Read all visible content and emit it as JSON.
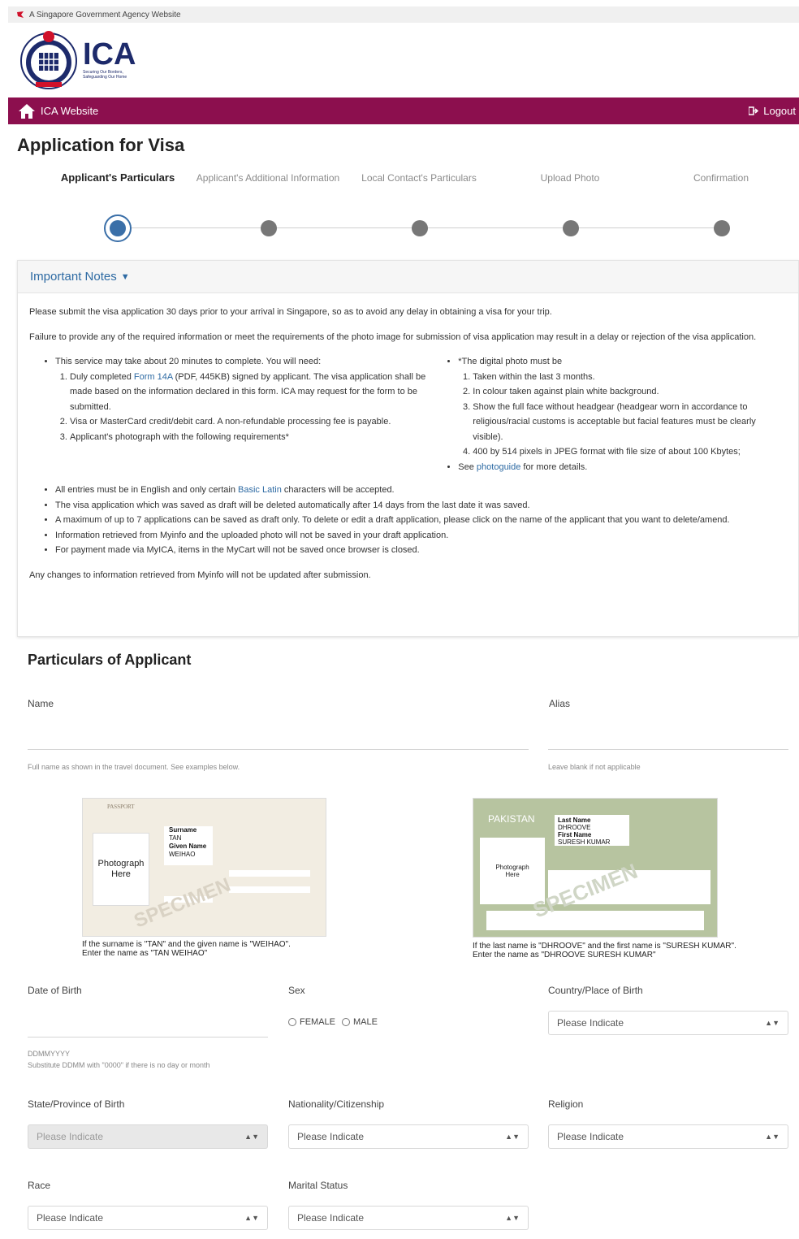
{
  "gov_banner": {
    "text": "A Singapore Government Agency Website"
  },
  "logo": {
    "acronym": "ICA",
    "tagline_1": "Securing Our Borders,",
    "tagline_2": "Safeguarding Our Home"
  },
  "nav": {
    "home_label": "ICA Website",
    "logout_label": "Logout"
  },
  "page_title": "Application for Visa",
  "steps": [
    {
      "label": "Applicant's Particulars",
      "active": true
    },
    {
      "label": "Applicant's Additional Information",
      "active": false
    },
    {
      "label": "Local Contact's Particulars",
      "active": false
    },
    {
      "label": "Upload Photo",
      "active": false
    },
    {
      "label": "Confirmation",
      "active": false
    }
  ],
  "notes": {
    "title": "Important Notes",
    "p1": "Please submit the visa application 30 days prior to your arrival in Singapore, so as to avoid any delay in obtaining a visa for your trip.",
    "p2": "Failure to provide any of the required information or meet the requirements of the photo image for submission of visa application may result in a delay or rejection of the visa application.",
    "left_intro": "This service may take about 20 minutes to complete. You will need:",
    "left_items": {
      "i1_pre": "Duly completed ",
      "i1_link": "Form 14A",
      "i1_post": " (PDF, 445KB) signed by applicant. The visa application shall be made based on the information declared in this form. ICA may request for the form to be submitted.",
      "i2": "Visa or MasterCard credit/debit card. A non-refundable processing fee is payable.",
      "i3": "Applicant's photograph with the following requirements*"
    },
    "right_intro": "*The digital photo must be",
    "right_items": {
      "r1": "Taken within the last 3 months.",
      "r2": "In colour taken against plain white background.",
      "r3": "Show the full face without headgear (headgear worn in accordance to religious/racial customs is acceptable but facial features must be clearly visible).",
      "r4": "400 by 514 pixels in JPEG format with file size of about 100 Kbytes;"
    },
    "see_pre": "See ",
    "see_link": "photoguide",
    "see_post": " for more details.",
    "b1_pre": "All entries must be in English and only certain ",
    "b1_link": "Basic Latin",
    "b1_post": " characters will be accepted.",
    "b2": "The visa application which was saved as draft will be deleted automatically after 14 days from the last date it was saved.",
    "b3": "A maximum of up to 7 applications can be saved as draft only. To delete or edit a draft application, please click on the name of the applicant that you want to delete/amend.",
    "b4": "Information retrieved from Myinfo and the uploaded photo will not be saved in your draft application.",
    "b5": "For payment made via MyICA, items in the MyCart will not be saved once browser is closed.",
    "footer": "Any changes to information retrieved from Myinfo will not be updated after submission."
  },
  "section_title": "Particulars of Applicant",
  "form": {
    "name_label": "Name",
    "name_hint": "Full name as shown in the travel document. See examples below.",
    "alias_label": "Alias",
    "alias_hint": "Leave blank if not applicable",
    "example1": {
      "doc_title": "PASSPORT",
      "surname_label": "Surname",
      "surname_value": "TAN",
      "given_label": "Given Name",
      "given_value": "WEIHAO",
      "photo_text_1": "Photograph",
      "photo_text_2": "Here",
      "specimen": "SPECIMEN",
      "caption_1": "If the surname is \"TAN\" and the given name is \"WEIHAO\".",
      "caption_2": "Enter the name as \"TAN WEIHAO\""
    },
    "example2": {
      "country": "PAKISTAN",
      "last_label": "Last Name",
      "last_value": "DHROOVE",
      "first_label": "First Name",
      "first_value": "SURESH KUMAR",
      "photo_text_1": "Photograph",
      "photo_text_2": "Here",
      "specimen": "SPECIMEN",
      "caption_1": "If the last name is \"DHROOVE\" and the first name is \"SURESH KUMAR\".",
      "caption_2": "Enter the name as \"DHROOVE SURESH KUMAR\""
    },
    "dob_label": "Date of Birth",
    "dob_hint_1": "DDMMYYYY",
    "dob_hint_2": "Substitute DDMM with \"0000\" if there is no day or month",
    "sex_label": "Sex",
    "sex_female": "FEMALE",
    "sex_male": "MALE",
    "cob_label": "Country/Place of Birth",
    "state_label": "State/Province of Birth",
    "nationality_label": "Nationality/Citizenship",
    "religion_label": "Religion",
    "race_label": "Race",
    "marital_label": "Marital Status",
    "placeholder": "Please Indicate"
  },
  "colors": {
    "brand_bar": "#8c0f4e",
    "link": "#2d6aa3",
    "active_step": "#3a6fa8"
  }
}
